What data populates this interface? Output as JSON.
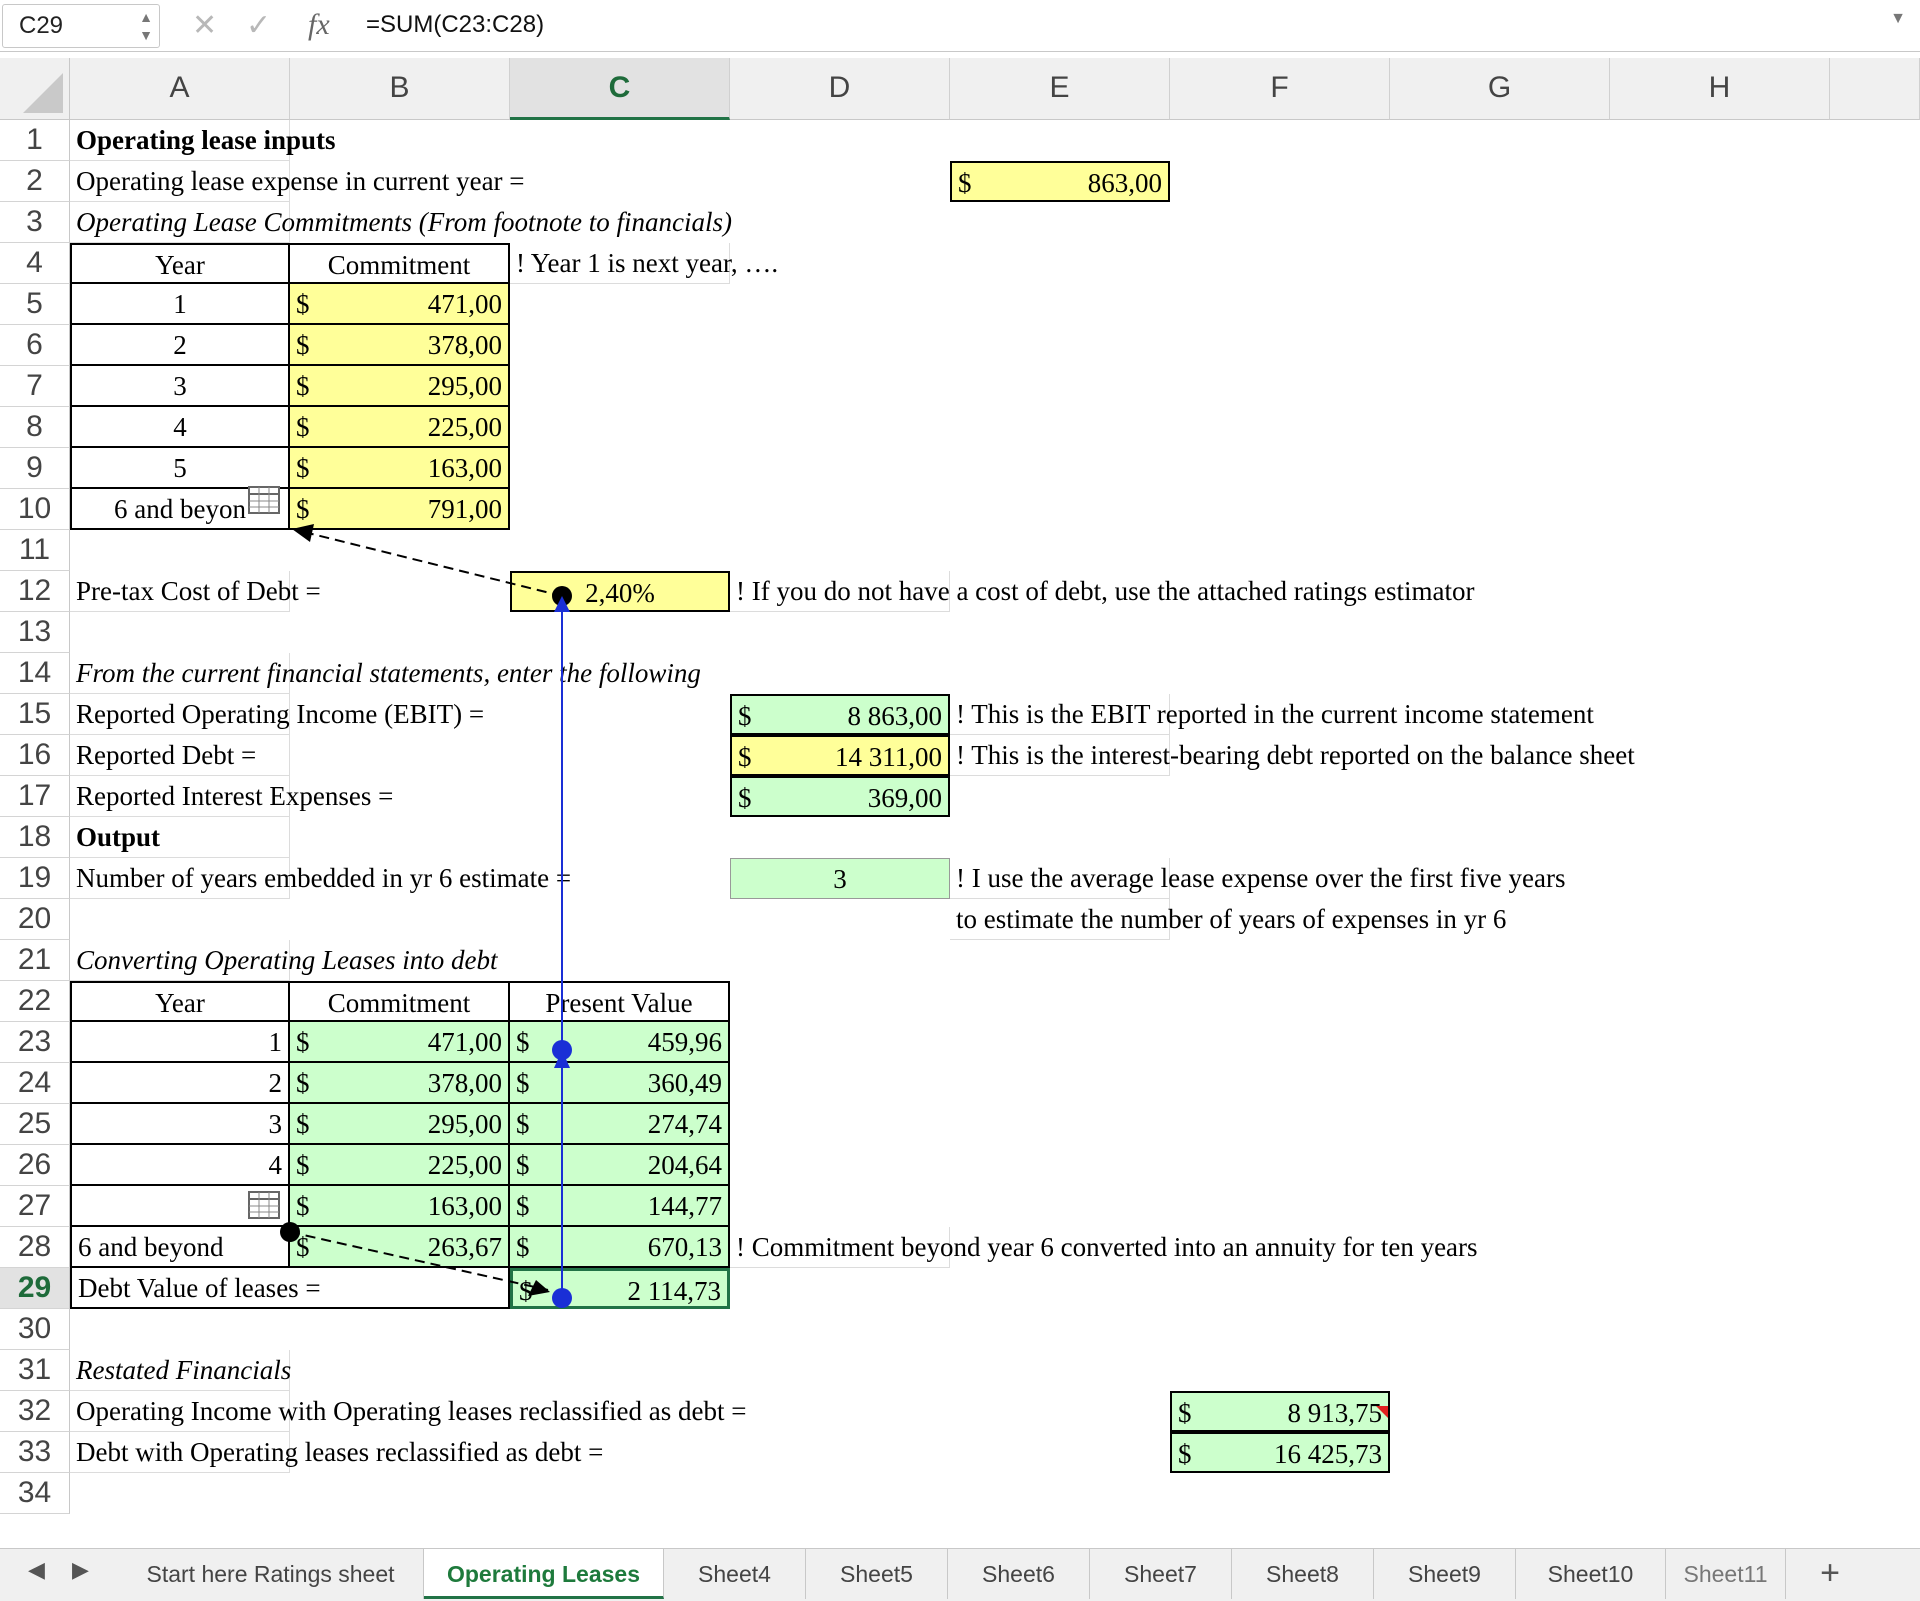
{
  "formula_bar": {
    "name_box": "C29",
    "formula": "=SUM(C23:C28)",
    "cancel_icon": "cancel-x-icon",
    "enter_icon": "checkmark-icon",
    "fx_label": "fx"
  },
  "columns": [
    "A",
    "B",
    "C",
    "D",
    "E",
    "F",
    "G",
    "H"
  ],
  "rows": [
    "1",
    "2",
    "3",
    "4",
    "5",
    "6",
    "7",
    "8",
    "9",
    "10",
    "11",
    "12",
    "13",
    "14",
    "15",
    "16",
    "17",
    "18",
    "19",
    "20",
    "21",
    "22",
    "23",
    "24",
    "25",
    "26",
    "27",
    "28",
    "29",
    "30",
    "31",
    "32",
    "33",
    "34"
  ],
  "cells": {
    "A1": "Operating lease inputs",
    "A2": "Operating lease expense in current year =",
    "E2_sym": "$",
    "E2_val": "863,00",
    "A3": "Operating Lease Commitments (From footnote to financials)",
    "A4": "Year",
    "B4": "Commitment",
    "C4": "! Year 1 is next year, ….",
    "A5": "1",
    "B5_sym": "$",
    "B5_val": "471,00",
    "A6": "2",
    "B6_sym": "$",
    "B6_val": "378,00",
    "A7": "3",
    "B7_sym": "$",
    "B7_val": "295,00",
    "A8": "4",
    "B8_sym": "$",
    "B8_val": "225,00",
    "A9": "5",
    "B9_sym": "$",
    "B9_val": "163,00",
    "A10": "6 and beyon",
    "B10_sym": "$",
    "B10_val": "791,00",
    "A12": "Pre-tax Cost of Debt =",
    "C12": "2,40%",
    "D12": "! If you do not have a cost of debt, use the attached ratings estimator",
    "A14": "From the current financial statements, enter the following",
    "A15": "Reported Operating Income (EBIT) =",
    "D15_sym": "$",
    "D15_val": "8 863,00",
    "E15": "! This is the EBIT reported in the current income statement",
    "A16": "Reported Debt =",
    "D16_sym": "$",
    "D16_val": "14 311,00",
    "E16": "! This is the interest-bearing debt reported on the balance sheet",
    "A17": "Reported Interest Expenses =",
    "D17_sym": "$",
    "D17_val": "369,00",
    "A18": "Output",
    "A19": "Number of years embedded in yr 6 estimate =",
    "D19": "3",
    "E19": "! I use the average lease expense over the first five years",
    "E20": "to estimate the number of years of expenses in yr 6",
    "A21": "Converting Operating Leases into debt",
    "A22": "Year",
    "B22": "Commitment",
    "C22": "Present Value",
    "A23": "1",
    "B23_sym": "$",
    "B23_val": "471,00",
    "C23_sym": "$",
    "C23_val": "459,96",
    "A24": "2",
    "B24_sym": "$",
    "B24_val": "378,00",
    "C24_sym": "$",
    "C24_val": "360,49",
    "A25": "3",
    "B25_sym": "$",
    "B25_val": "295,00",
    "C25_sym": "$",
    "C25_val": "274,74",
    "A26": "4",
    "B26_sym": "$",
    "B26_val": "225,00",
    "C26_sym": "$",
    "C26_val": "204,64",
    "B27_sym": "$",
    "B27_val": "163,00",
    "C27_sym": "$",
    "C27_val": "144,77",
    "A28": "6 and beyond",
    "B28_sym": "$",
    "B28_val": "263,67",
    "C28_sym": "$",
    "C28_val": "670,13",
    "D28": "! Commitment beyond year 6 converted into an annuity for ten years",
    "A29": "Debt Value of leases =",
    "C29_sym": "$",
    "C29_val": "2 114,73",
    "A31": "Restated Financials",
    "A32": "Operating Income with Operating leases reclassified as debt =",
    "F32_sym": "$",
    "F32_val": "8 913,75",
    "A33": "Debt with Operating leases reclassified as debt =",
    "F33_sym": "$",
    "F33_val": "16 425,73"
  },
  "sheet_tabs": [
    {
      "label": "Start here Ratings sheet",
      "active": false
    },
    {
      "label": "Operating Leases",
      "active": true
    },
    {
      "label": "Sheet4",
      "active": false
    },
    {
      "label": "Sheet5",
      "active": false
    },
    {
      "label": "Sheet6",
      "active": false
    },
    {
      "label": "Sheet7",
      "active": false
    },
    {
      "label": "Sheet8",
      "active": false
    },
    {
      "label": "Sheet9",
      "active": false
    },
    {
      "label": "Sheet10",
      "active": false
    },
    {
      "label": "Sheet11",
      "active": false
    }
  ],
  "tab_add_label": "+",
  "colors": {
    "input_yellow": "#ffff99",
    "calc_green": "#ccffcc",
    "selection_green": "#217346",
    "tracer_blue": "#1a2fd6"
  }
}
